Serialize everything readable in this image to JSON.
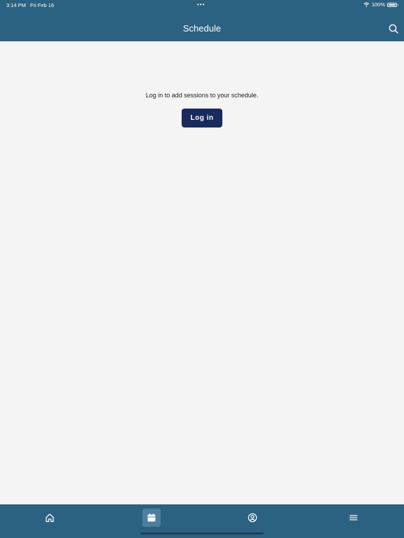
{
  "status_bar": {
    "time": "3:14 PM",
    "date": "Fri Feb 16",
    "dots": "•••",
    "battery": "100%",
    "icons": [
      "wifi-icon",
      "battery-icon"
    ]
  },
  "header": {
    "title": "Schedule",
    "search_icon": "search-icon"
  },
  "main": {
    "message": "Log in to add sessions to your schedule.",
    "login_label": "Log in"
  },
  "tabbar": {
    "active_index": 1,
    "tabs": [
      {
        "icon": "home-icon"
      },
      {
        "icon": "calendar-icon"
      },
      {
        "icon": "profile-icon"
      },
      {
        "icon": "menu-icon"
      }
    ]
  },
  "colors": {
    "header_bg": "#2c6281",
    "page_bg": "#f4f4f4",
    "button_bg": "#1a2a5c",
    "active_tab_bg": "#4d7e9c"
  }
}
